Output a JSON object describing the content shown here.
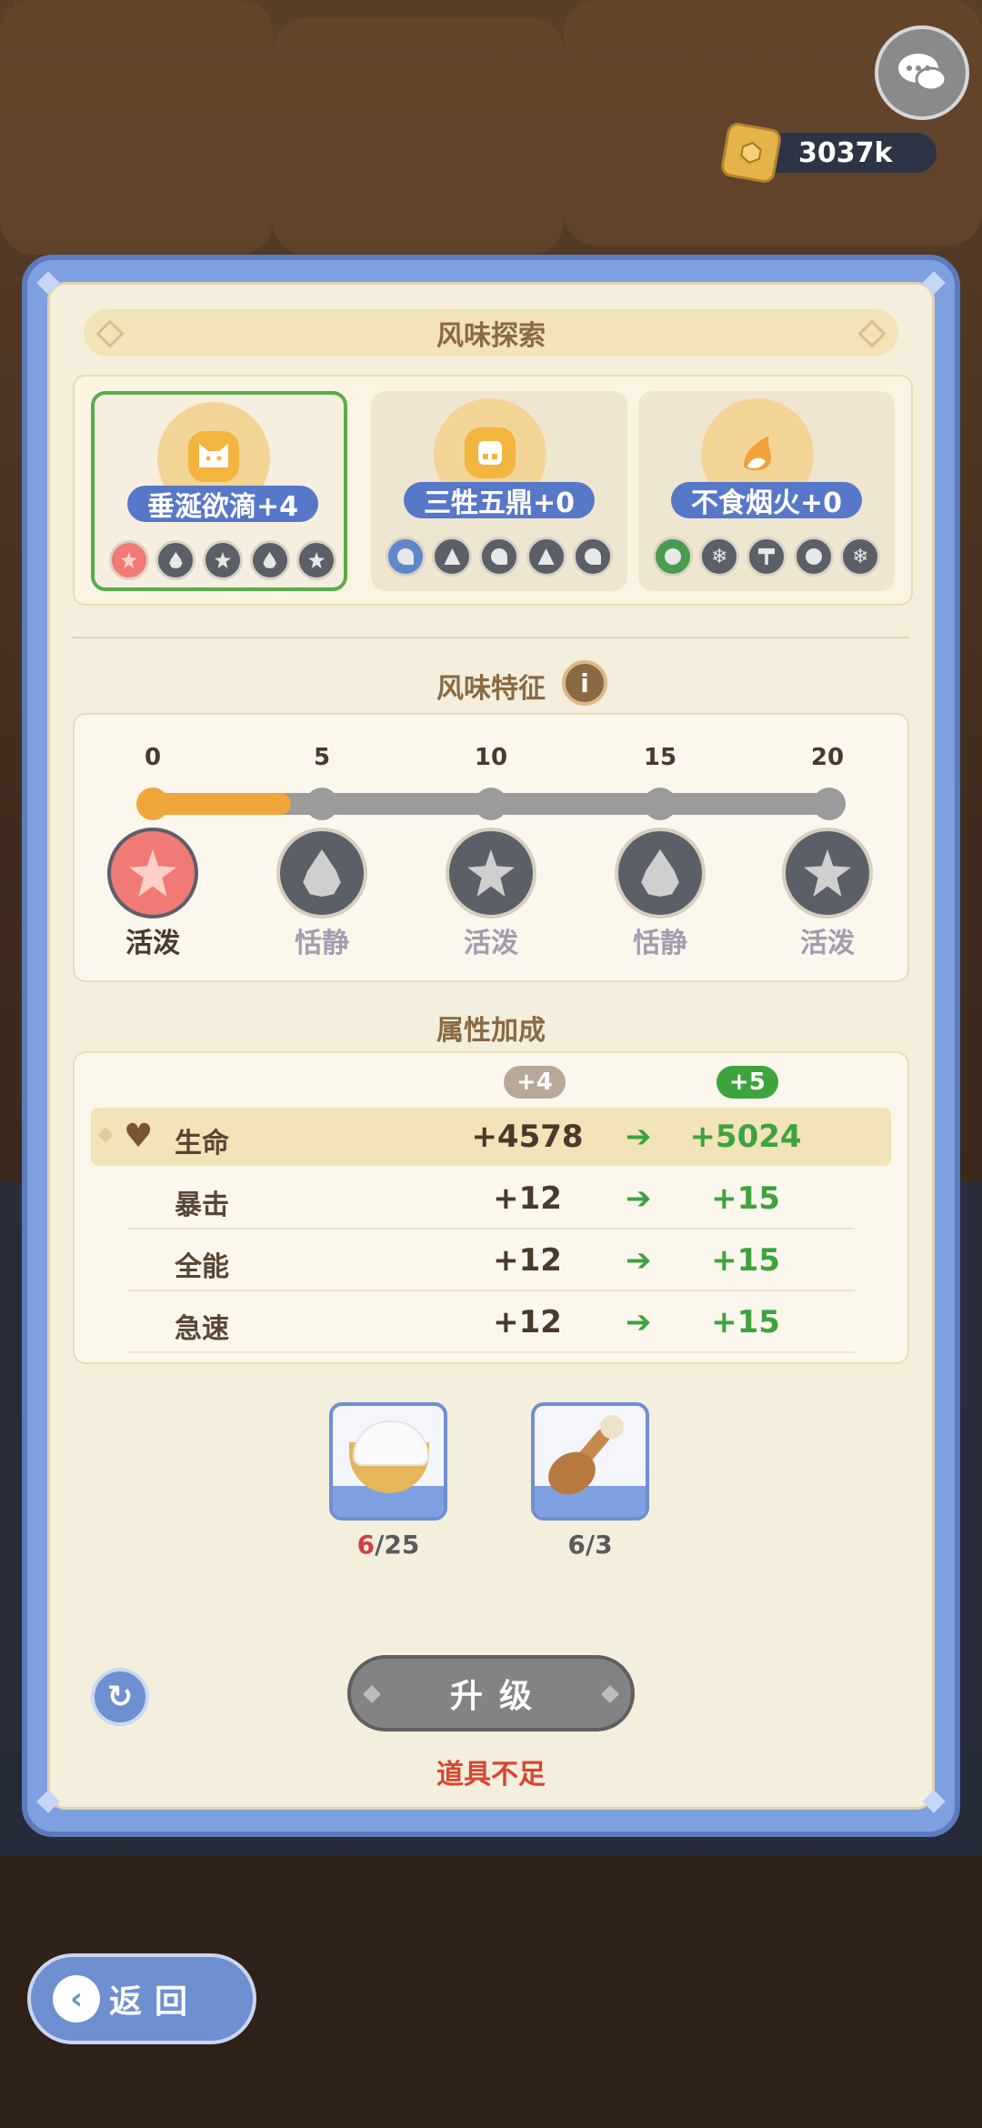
{
  "currency": {
    "value": "3037k",
    "icon": "coin-icon"
  },
  "panel": {
    "title": "风味探索"
  },
  "flavors": [
    {
      "name": "垂涎欲滴+4",
      "selected": true,
      "icon": "cat-face-icon",
      "mini": [
        {
          "shape": "star",
          "active": true
        },
        {
          "shape": "drop",
          "active": false
        },
        {
          "shape": "star",
          "active": false
        },
        {
          "shape": "drop",
          "active": false
        },
        {
          "shape": "star",
          "active": false
        }
      ]
    },
    {
      "name": "三牲五鼎+0",
      "selected": false,
      "icon": "pudding-icon",
      "mini": [
        {
          "shape": "arm",
          "active": false
        },
        {
          "shape": "triangle",
          "active": false
        },
        {
          "shape": "arm",
          "active": false
        },
        {
          "shape": "triangle",
          "active": false
        },
        {
          "shape": "arm",
          "active": false
        }
      ]
    },
    {
      "name": "不食烟火+0",
      "selected": false,
      "icon": "fox-tail-icon",
      "mini": [
        {
          "shape": "ball",
          "active": false
        },
        {
          "shape": "snowflake",
          "active": false
        },
        {
          "shape": "hammer",
          "active": false
        },
        {
          "shape": "ball",
          "active": false
        },
        {
          "shape": "snowflake",
          "active": false
        }
      ]
    }
  ],
  "traits_section": {
    "title": "风味特征",
    "ticks": [
      "0",
      "5",
      "10",
      "15",
      "20"
    ],
    "progress": 4,
    "max": 20,
    "traits": [
      {
        "label": "活泼",
        "shape": "star",
        "active": true
      },
      {
        "label": "恬静",
        "shape": "drop",
        "active": false
      },
      {
        "label": "活泼",
        "shape": "star",
        "active": false
      },
      {
        "label": "恬静",
        "shape": "drop",
        "active": false
      },
      {
        "label": "活泼",
        "shape": "star",
        "active": false
      }
    ]
  },
  "attributes": {
    "title": "属性加成",
    "current_level": "+4",
    "next_level": "+5",
    "rows": [
      {
        "name": "生命",
        "current": "+4578",
        "next": "+5024",
        "highlight": true
      },
      {
        "name": "暴击",
        "current": "+12",
        "next": "+15",
        "highlight": false
      },
      {
        "name": "全能",
        "current": "+12",
        "next": "+15",
        "highlight": false
      },
      {
        "name": "急速",
        "current": "+12",
        "next": "+15",
        "highlight": false
      }
    ]
  },
  "materials": [
    {
      "icon": "rice-bowl-icon",
      "have": "6",
      "need": "/25",
      "insufficient": true
    },
    {
      "icon": "wooden-spoon-icon",
      "have": "6",
      "need": "/3",
      "insufficient": false
    }
  ],
  "upgrade_label": "升级",
  "warning": "道具不足",
  "back_label": "返回",
  "colors": {
    "accent_blue": "#6e8fd0",
    "gain_green": "#3da33d",
    "warn_red": "#d9452f",
    "progress_orange": "#f0a63a"
  }
}
